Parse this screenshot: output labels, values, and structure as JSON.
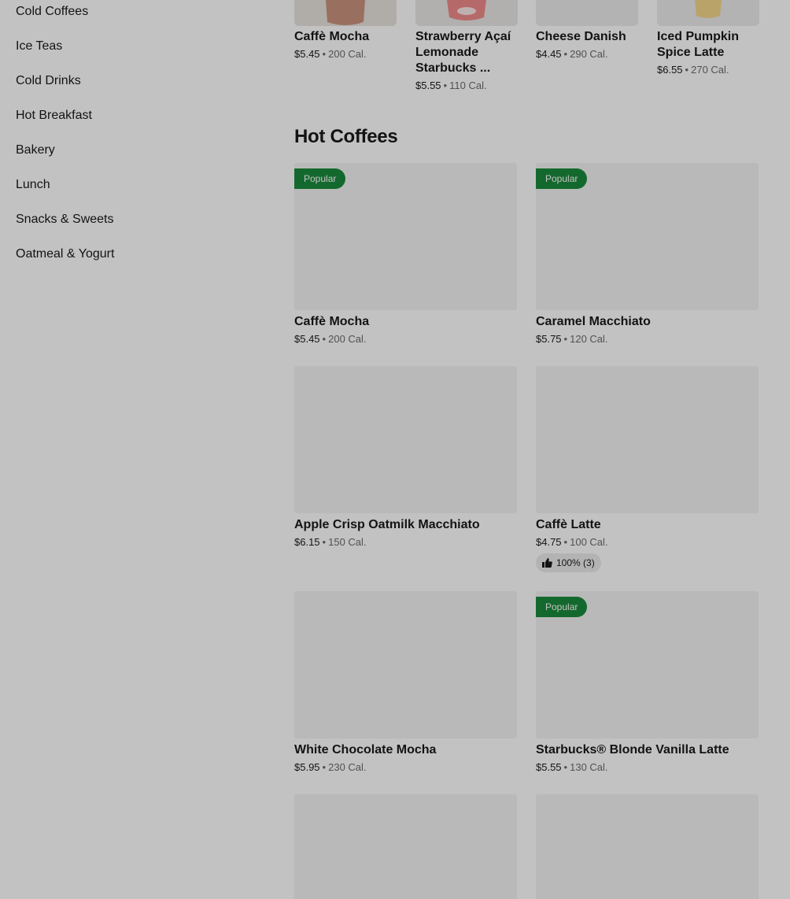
{
  "sidebar": {
    "categories": [
      "Cold Coffees",
      "Ice Teas",
      "Cold Drinks",
      "Hot Breakfast",
      "Bakery",
      "Lunch",
      "Snacks & Sweets",
      "Oatmeal & Yogurt"
    ]
  },
  "carousel": [
    {
      "name": "Caffè Mocha",
      "price": "$5.45",
      "cal": "200 Cal."
    },
    {
      "name": "Strawberry Açaí Lemonade Starbucks ...",
      "price": "$5.55",
      "cal": "110 Cal."
    },
    {
      "name": "Cheese Danish",
      "price": "$4.45",
      "cal": "290 Cal."
    },
    {
      "name": "Iced Pumpkin Spice Latte",
      "price": "$6.55",
      "cal": "270 Cal."
    }
  ],
  "section": {
    "title": "Hot Coffees",
    "badge_label": "Popular",
    "items": [
      {
        "name": "Caffè Mocha",
        "price": "$5.45",
        "cal": "200 Cal.",
        "popular": true
      },
      {
        "name": "Caramel Macchiato",
        "price": "$5.75",
        "cal": "120 Cal.",
        "popular": true
      },
      {
        "name": "Apple Crisp Oatmilk Macchiato",
        "price": "$6.15",
        "cal": "150 Cal.",
        "popular": false
      },
      {
        "name": "Caffè Latte",
        "price": "$4.75",
        "cal": "100 Cal.",
        "popular": false,
        "rating": "100% (3)"
      },
      {
        "name": "White Chocolate Mocha",
        "price": "$5.95",
        "cal": "230 Cal.",
        "popular": false
      },
      {
        "name": "Starbucks® Blonde Vanilla Latte",
        "price": "$5.55",
        "cal": "130 Cal.",
        "popular": true
      }
    ]
  },
  "separator": "•",
  "colors": {
    "badge": "#1a8a3c",
    "image_placeholder": "#f3f3f3",
    "scrim": "rgba(0,0,0,0.24)"
  },
  "icons": {
    "rating": "thumbs-up-icon"
  }
}
